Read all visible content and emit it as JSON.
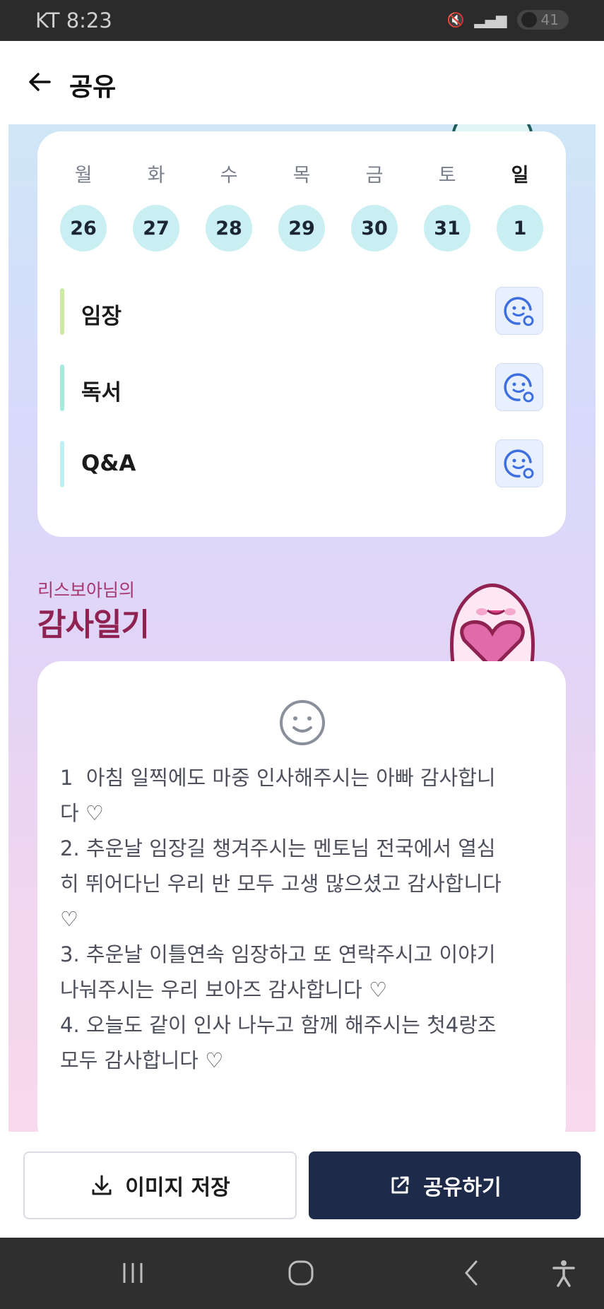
{
  "status_bar": {
    "carrier_time": "KT 8:23",
    "battery": "41"
  },
  "app_bar": {
    "title": "공유"
  },
  "week": {
    "days": [
      "월",
      "화",
      "수",
      "목",
      "금",
      "토",
      "일"
    ],
    "dates": [
      "26",
      "27",
      "28",
      "29",
      "30",
      "31",
      "1"
    ]
  },
  "habits": [
    {
      "label": "임장",
      "bar_color": "#cdeaa3"
    },
    {
      "label": "독서",
      "bar_color": "#a7eadf"
    },
    {
      "label": "Q&A",
      "bar_color": "#bfeff1"
    }
  ],
  "journal": {
    "owner": "리스보아님의",
    "title": "감사일기",
    "text": "1  아침 일찍에도 마중 인사해주시는 아빠 감사합니\n다 ♡\n2. 추운날 임장길 챙겨주시는 멘토님 전국에서 열심\n히 뛰어다닌 우리 반 모두 고생 많으셨고 감사합니다\n♡\n3. 추운날 이틀연속 임장하고 또 연락주시고 이야기\n나눠주시는 우리 보아즈 감사합니다 ♡\n4. 오늘도 같이 인사 나누고 함께 해주시는 첫4랑조\n모두 감사합니다 ♡"
  },
  "actions": {
    "save_label": "이미지 저장",
    "share_label": "공유하기"
  },
  "colors": {
    "accent": "#1e2a4a",
    "title_color": "#8f2250",
    "date_circle": "#c9eff3"
  },
  "icons": [
    "back-arrow-icon",
    "download-icon",
    "external-share-icon",
    "smile-icon",
    "emotion-add-icon"
  ]
}
